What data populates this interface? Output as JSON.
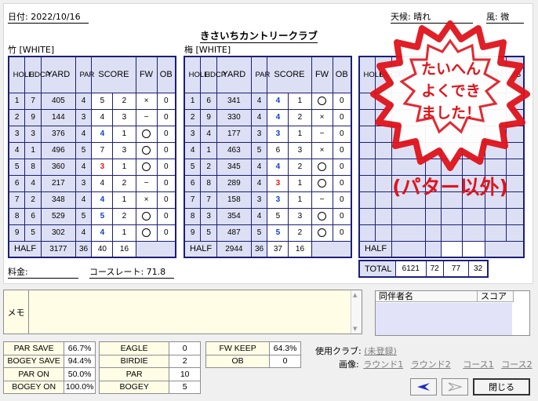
{
  "header": {
    "date": "日付: 2022/10/16",
    "weather": "天候: 晴れ",
    "wind": "風: 微",
    "course_name": "きさいちカントリークラブ"
  },
  "labels": {
    "hole": "HOLE",
    "hdcp": "HDCP",
    "yard": "YARD",
    "par": "PAR",
    "score": "SCORE",
    "fw": "FW",
    "ob": "OB",
    "half": "HALF",
    "total": "TOTAL"
  },
  "front": {
    "name": "竹 [WHITE]",
    "holes": [
      {
        "hole": "1",
        "hdcp": "7",
        "yard": "405",
        "par": "4",
        "score": "5",
        "putts": "2",
        "fw": "×",
        "ob": "0"
      },
      {
        "hole": "2",
        "hdcp": "9",
        "yard": "144",
        "par": "3",
        "score": "4",
        "putts": "3",
        "fw": "−",
        "ob": "0"
      },
      {
        "hole": "3",
        "hdcp": "3",
        "yard": "376",
        "par": "4",
        "score": "4",
        "putts": "1",
        "fw": "○",
        "ob": "0"
      },
      {
        "hole": "4",
        "hdcp": "1",
        "yard": "496",
        "par": "5",
        "score": "7",
        "putts": "3",
        "fw": "○",
        "ob": "0"
      },
      {
        "hole": "5",
        "hdcp": "8",
        "yard": "360",
        "par": "4",
        "score": "3",
        "putts": "1",
        "fw": "○",
        "ob": "0"
      },
      {
        "hole": "6",
        "hdcp": "4",
        "yard": "217",
        "par": "3",
        "score": "4",
        "putts": "2",
        "fw": "−",
        "ob": "0"
      },
      {
        "hole": "7",
        "hdcp": "2",
        "yard": "348",
        "par": "4",
        "score": "4",
        "putts": "1",
        "fw": "×",
        "ob": "0"
      },
      {
        "hole": "8",
        "hdcp": "6",
        "yard": "529",
        "par": "5",
        "score": "5",
        "putts": "2",
        "fw": "○",
        "ob": "0"
      },
      {
        "hole": "9",
        "hdcp": "5",
        "yard": "302",
        "par": "4",
        "score": "4",
        "putts": "1",
        "fw": "○",
        "ob": "0"
      }
    ],
    "half": {
      "yard": "3177",
      "par": "36",
      "score": "40",
      "putts": "16"
    }
  },
  "back": {
    "name": "梅 [WHITE]",
    "holes": [
      {
        "hole": "1",
        "hdcp": "6",
        "yard": "341",
        "par": "4",
        "score": "4",
        "putts": "1",
        "fw": "○",
        "ob": "0"
      },
      {
        "hole": "2",
        "hdcp": "9",
        "yard": "330",
        "par": "4",
        "score": "4",
        "putts": "2",
        "fw": "×",
        "ob": "0"
      },
      {
        "hole": "3",
        "hdcp": "4",
        "yard": "177",
        "par": "3",
        "score": "3",
        "putts": "1",
        "fw": "−",
        "ob": "0"
      },
      {
        "hole": "4",
        "hdcp": "1",
        "yard": "463",
        "par": "5",
        "score": "6",
        "putts": "3",
        "fw": "×",
        "ob": "0"
      },
      {
        "hole": "5",
        "hdcp": "2",
        "yard": "345",
        "par": "4",
        "score": "4",
        "putts": "2",
        "fw": "○",
        "ob": "0"
      },
      {
        "hole": "6",
        "hdcp": "8",
        "yard": "289",
        "par": "4",
        "score": "3",
        "putts": "1",
        "fw": "○",
        "ob": "0"
      },
      {
        "hole": "7",
        "hdcp": "7",
        "yard": "158",
        "par": "3",
        "score": "3",
        "putts": "1",
        "fw": "−",
        "ob": "0"
      },
      {
        "hole": "8",
        "hdcp": "3",
        "yard": "354",
        "par": "4",
        "score": "5",
        "putts": "3",
        "fw": "○",
        "ob": "0"
      },
      {
        "hole": "9",
        "hdcp": "5",
        "yard": "487",
        "par": "5",
        "score": "5",
        "putts": "2",
        "fw": "○",
        "ob": "0"
      }
    ],
    "half": {
      "yard": "2944",
      "par": "36",
      "score": "37",
      "putts": "16"
    }
  },
  "total": {
    "yard": "6121",
    "par": "72",
    "score": "77",
    "putts": "32"
  },
  "fee_label": "料金:",
  "course_rate": "コースレート:  71.8",
  "stamp": {
    "line1": "たいへん",
    "line2": "よくでき",
    "line3": "ました！",
    "note": "(パター以外)"
  },
  "memo_label": "メモ",
  "companions": {
    "name_header": "同伴者名",
    "score_header": "スコア"
  },
  "stats1": [
    {
      "label": "PAR SAVE",
      "value": "66.7%"
    },
    {
      "label": "BOGEY SAVE",
      "value": "94.4%"
    },
    {
      "label": "PAR ON",
      "value": "50.0%"
    },
    {
      "label": "BOGEY ON",
      "value": "100.0%"
    }
  ],
  "stats2": [
    {
      "label": "EAGLE",
      "value": "0"
    },
    {
      "label": "BIRDIE",
      "value": "2"
    },
    {
      "label": "PAR",
      "value": "10"
    },
    {
      "label": "BOGEY",
      "value": "5"
    }
  ],
  "stats3": [
    {
      "label": "FW KEEP",
      "value": "64.3%"
    },
    {
      "label": "OB",
      "value": "0"
    }
  ],
  "club_label": "使用クラブ:",
  "club_value": "(未登録)",
  "image_label": "画像:",
  "image_links": [
    "ラウンド1",
    "ラウンド2",
    "コース1",
    "コース2"
  ],
  "close_label": "閉じる",
  "colors": {
    "navy": "#1c1e78",
    "grid_bg": "#dde0f4",
    "blue_score": "#0d3fc7",
    "red_score": "#e01b1b",
    "stamp_red": "#e0141c"
  }
}
